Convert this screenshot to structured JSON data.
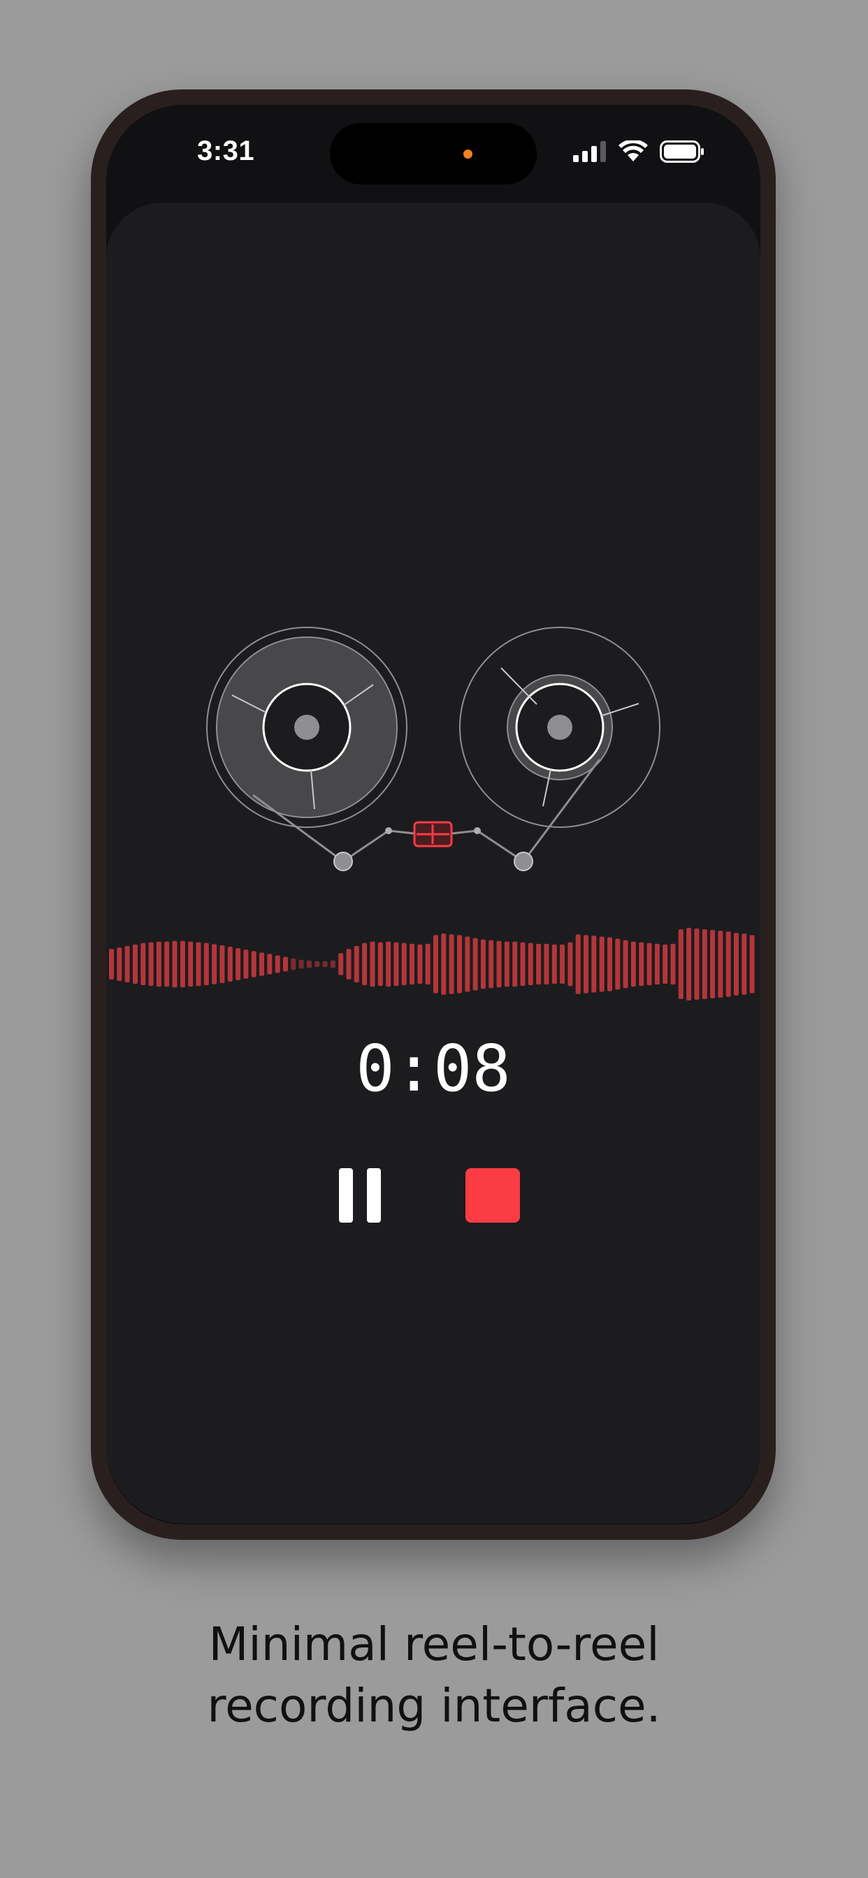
{
  "status_bar": {
    "time": "3:31",
    "icons": [
      "cellular-signal-icon",
      "wifi-icon",
      "battery-icon"
    ],
    "indicator_color": "#f5821f"
  },
  "recorder": {
    "elapsed": "0:08",
    "controls": {
      "pause_icon": "pause-icon",
      "stop_icon": "stop-icon"
    },
    "colors": {
      "accent": "#fc3c44",
      "waveform": "#c43a3e",
      "background": "#1c1c1e"
    },
    "waveform_levels": [
      0.42,
      0.46,
      0.5,
      0.54,
      0.58,
      0.6,
      0.62,
      0.62,
      0.64,
      0.64,
      0.62,
      0.6,
      0.58,
      0.55,
      0.52,
      0.48,
      0.44,
      0.4,
      0.36,
      0.32,
      0.28,
      0.24,
      0.2,
      0.16,
      0.12,
      0.1,
      0.08,
      0.08,
      0.1,
      0.3,
      0.42,
      0.5,
      0.58,
      0.62,
      0.6,
      0.62,
      0.6,
      0.58,
      0.56,
      0.54,
      0.56,
      0.8,
      0.84,
      0.82,
      0.8,
      0.76,
      0.72,
      0.68,
      0.66,
      0.64,
      0.62,
      0.62,
      0.6,
      0.58,
      0.56,
      0.56,
      0.54,
      0.54,
      0.6,
      0.82,
      0.8,
      0.78,
      0.76,
      0.74,
      0.7,
      0.66,
      0.62,
      0.6,
      0.58,
      0.56,
      0.54,
      0.56,
      0.96,
      1.0,
      0.98,
      0.96,
      0.94,
      0.92,
      0.9,
      0.86,
      0.84,
      0.8
    ]
  },
  "caption": {
    "line1": "Minimal reel-to-reel",
    "line2": "recording interface."
  }
}
